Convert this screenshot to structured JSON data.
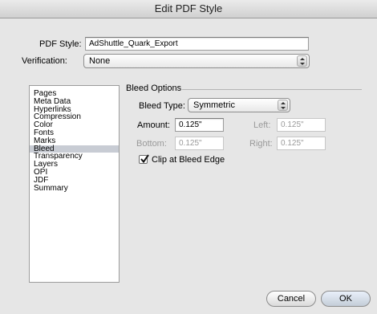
{
  "window": {
    "title": "Edit PDF Style"
  },
  "form": {
    "pdf_style_label": "PDF Style:",
    "pdf_style_value": "AdShuttle_Quark_Export",
    "verification_label": "Verification:",
    "verification_value": "None"
  },
  "sidebar": {
    "items": [
      {
        "label": "Pages"
      },
      {
        "label": "Meta Data"
      },
      {
        "label": "Hyperlinks"
      },
      {
        "label": "Compression"
      },
      {
        "label": "Color"
      },
      {
        "label": "Fonts"
      },
      {
        "label": "Marks"
      },
      {
        "label": "Bleed",
        "selected": true
      },
      {
        "label": "Transparency"
      },
      {
        "label": "Layers"
      },
      {
        "label": "OPI"
      },
      {
        "label": "JDF"
      },
      {
        "label": "Summary"
      }
    ]
  },
  "bleed": {
    "group_title": "Bleed Options",
    "type_label": "Bleed Type:",
    "type_value": "Symmetric",
    "amount_label": "Amount:",
    "amount_value": "0.125\"",
    "left_label": "Left:",
    "left_value": "0.125\"",
    "bottom_label": "Bottom:",
    "bottom_value": "0.125\"",
    "right_label": "Right:",
    "right_value": "0.125\"",
    "clip_label": "Clip at Bleed Edge",
    "clip_checked": true
  },
  "buttons": {
    "cancel": "Cancel",
    "ok": "OK"
  }
}
